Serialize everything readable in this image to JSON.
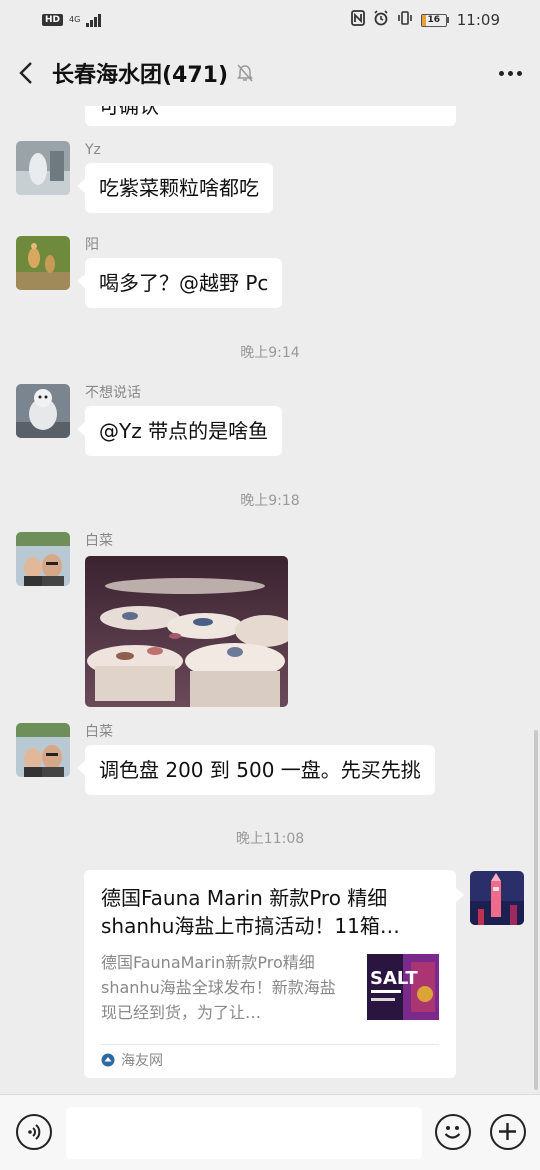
{
  "status_bar": {
    "hd": "HD",
    "network": "4G",
    "battery": "16",
    "battery_level": 0.16,
    "time": "11:09",
    "icons": [
      "nfc-icon",
      "alarm-icon",
      "vibrate-icon",
      "battery-icon"
    ]
  },
  "header": {
    "title": "长春海水团(471)",
    "icons": [
      "back-icon",
      "mute-icon",
      "more-icon"
    ]
  },
  "messages": {
    "partial_text": "可确认",
    "m1": {
      "sender": "Yz",
      "text": "吃紫菜颗粒啥都吃"
    },
    "m2": {
      "sender": "阳",
      "text": "喝多了？@越野 Pc"
    },
    "t1": "晚上9:14",
    "m3": {
      "sender": "不想说话",
      "text": "@Yz  带点的是啥鱼"
    },
    "t2": "晚上9:18",
    "m4": {
      "sender": "白菜"
    },
    "m5": {
      "sender": "白菜",
      "text": "调色盘 200 到 500 一盘。先买先挑"
    },
    "t3": "晚上11:08"
  },
  "card": {
    "title": "德国Fauna Marin 新款Pro 精细shanhu海盐上市搞活动！11箱…",
    "desc": "德国FaunaMarin新款Pro精细shanhu海盐全球发布！新款海盐现已经到货，为了让…",
    "thumb_text": "SALT",
    "source": "海友网"
  },
  "input": {
    "value": ""
  },
  "colors": {
    "background": "#ededed",
    "bubble": "#ffffff",
    "input_bar": "#f7f7f7"
  }
}
